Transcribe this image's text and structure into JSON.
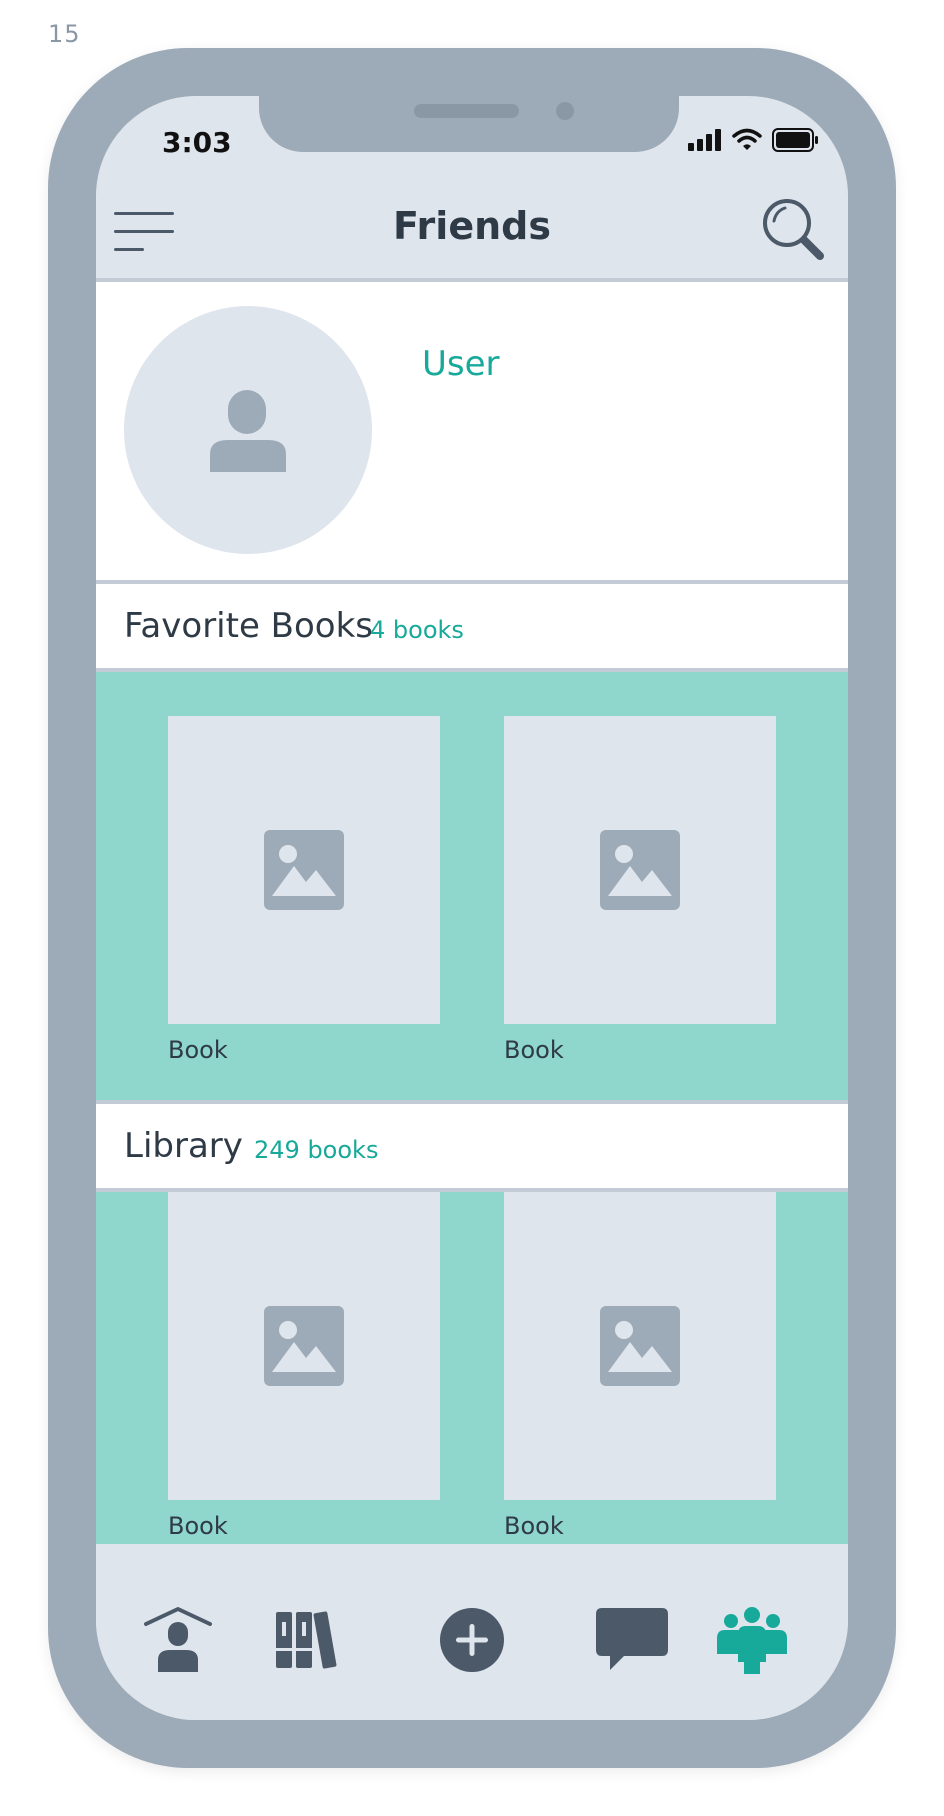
{
  "page_number": "15",
  "status_bar": {
    "time": "3:03"
  },
  "header": {
    "title": "Friends",
    "menu_icon": "hamburger-menu-icon",
    "search_icon": "search-icon"
  },
  "profile": {
    "user_name": "User",
    "avatar_icon": "user-silhouette-icon"
  },
  "favorite_books": {
    "title": "Favorite Books",
    "count": "4 books",
    "books": [
      {
        "label": "Book"
      },
      {
        "label": "Book"
      }
    ]
  },
  "library": {
    "title": "Library",
    "count": "249 books",
    "books": [
      {
        "label": "Book"
      },
      {
        "label": "Book"
      }
    ]
  },
  "tab_bar": {
    "tabs": [
      {
        "icon": "home-profile-icon",
        "active": false
      },
      {
        "icon": "bookshelf-icon",
        "active": false
      },
      {
        "icon": "add-circle-icon",
        "active": false
      },
      {
        "icon": "chat-bubble-icon",
        "active": false
      },
      {
        "icon": "friends-group-icon",
        "active": true
      }
    ]
  },
  "colors": {
    "accent": "#17a99a",
    "shelf_bg": "#8fd6cd",
    "frame": "#9dabb8",
    "screen_bg": "#dfe5ed",
    "text_dark": "#2e3a46",
    "icon_dark": "#4b5968"
  }
}
